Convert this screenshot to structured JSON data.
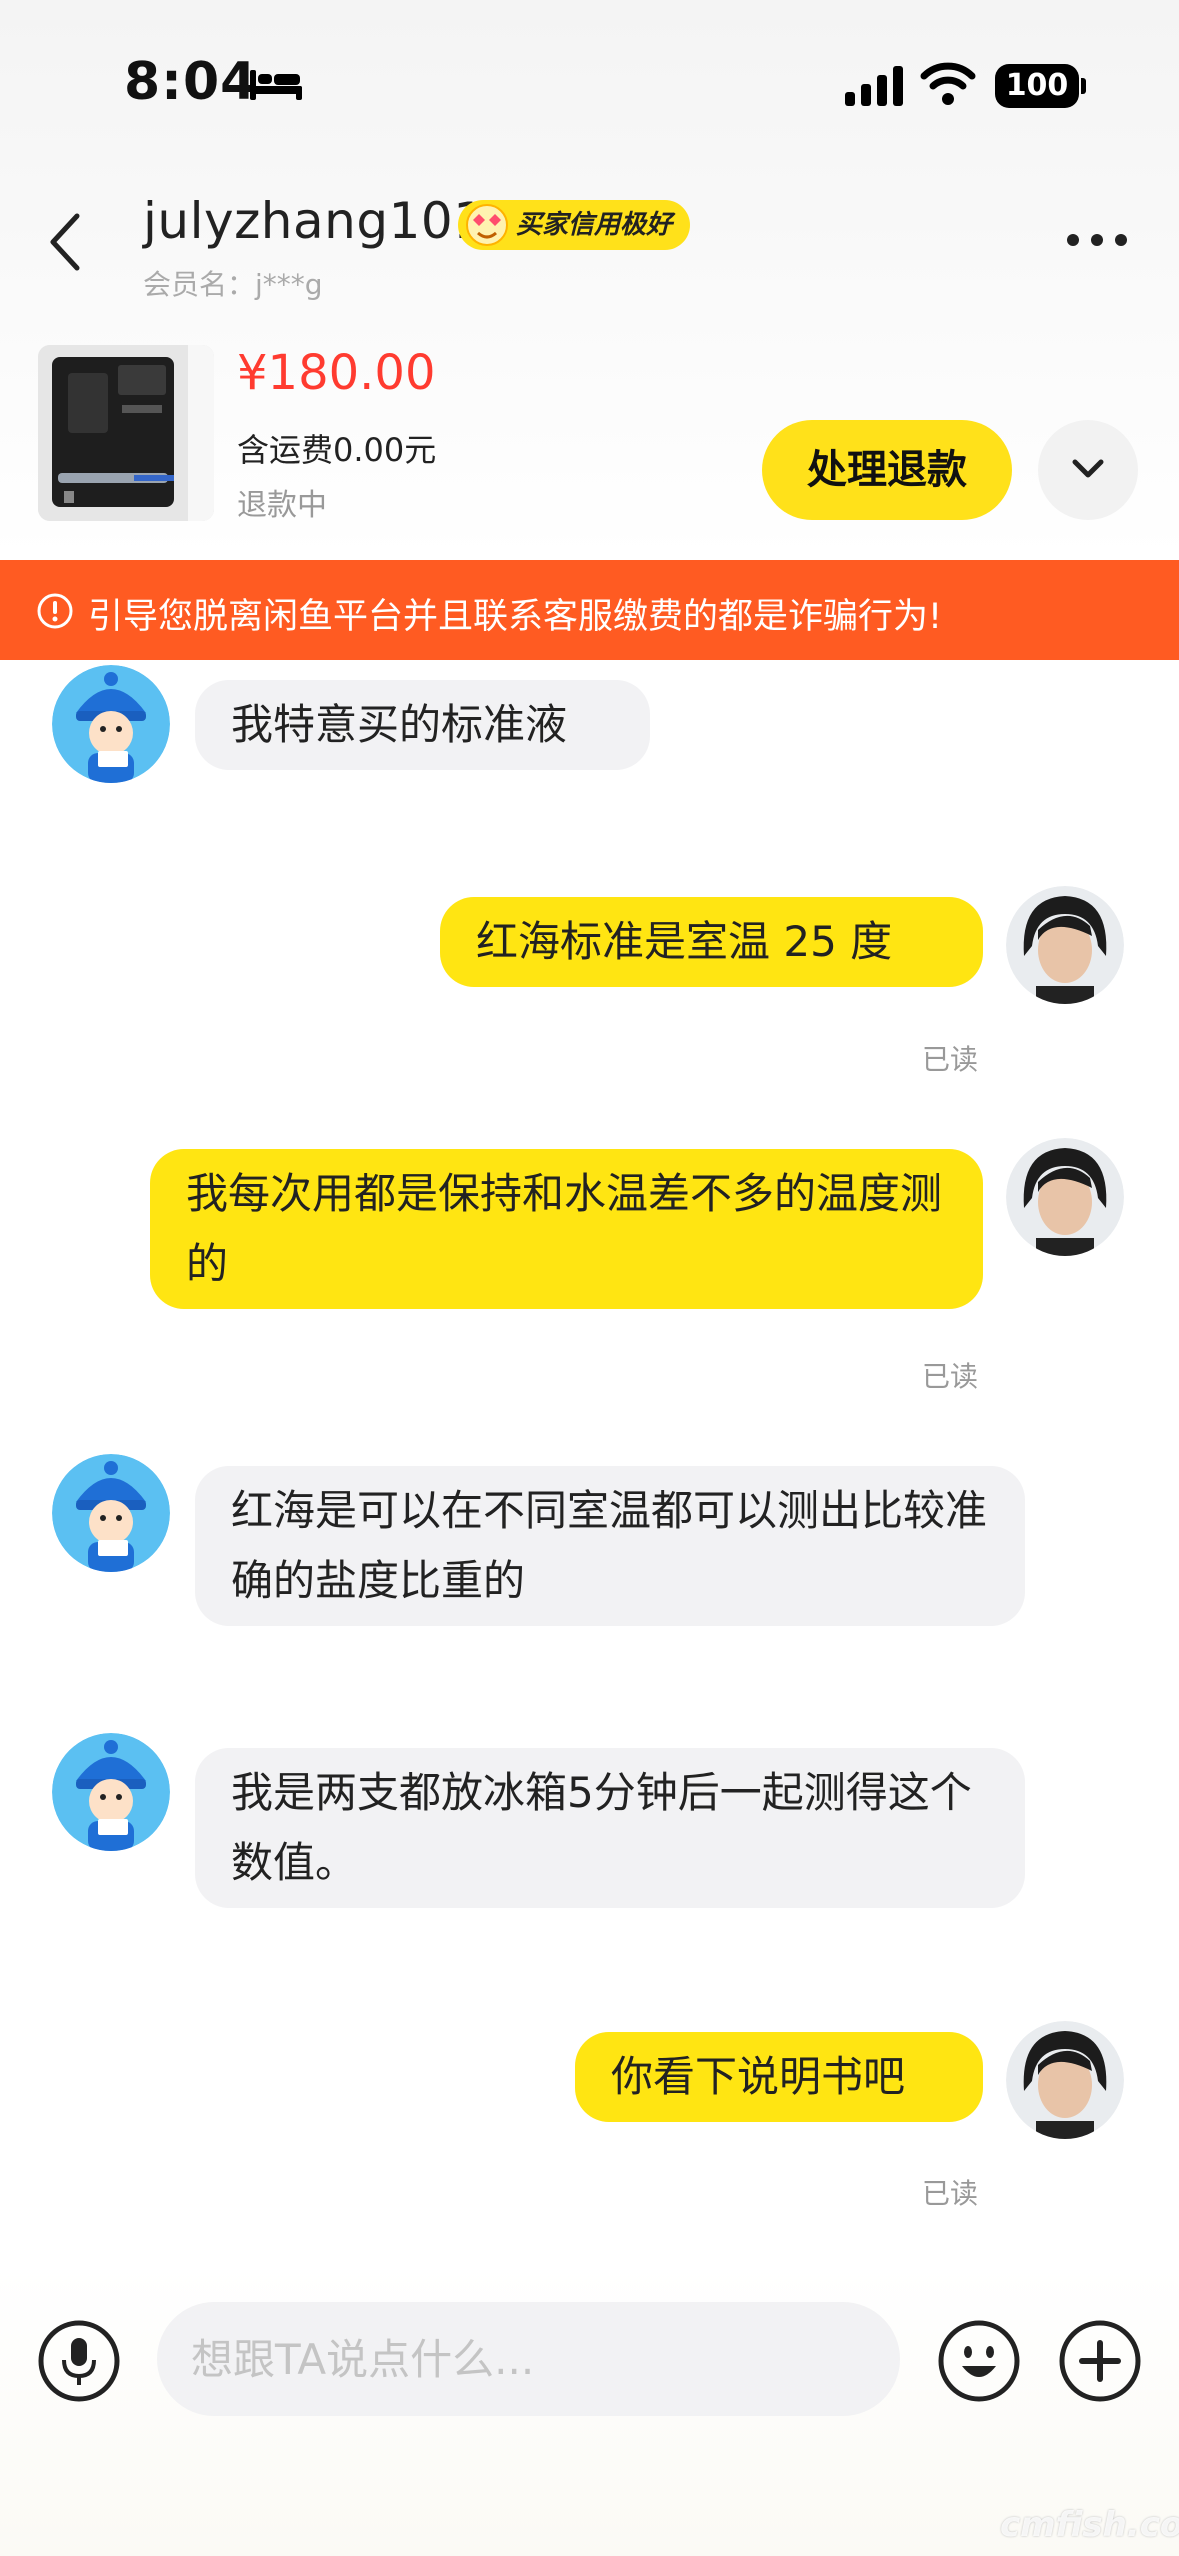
{
  "status_bar": {
    "time": "8:04",
    "battery": "100"
  },
  "header": {
    "user_name": "julyzhang101",
    "credit_badge": "买家信用极好",
    "member_label": "会员名：j***g"
  },
  "product": {
    "price": "¥180.00",
    "shipping": "含运费0.00元",
    "status": "退款中",
    "action_button": "处理退款"
  },
  "warning_banner": "引导您脱离闲鱼平台并且联系客服缴费的都是诈骗行为!",
  "messages": [
    {
      "side": "left",
      "text": "我特意买的标准液"
    },
    {
      "side": "right",
      "text": "红海标准是室温 25 度",
      "read": "已读"
    },
    {
      "side": "right",
      "text": "我每次用都是保持和水温差不多的温度测的",
      "read": "已读"
    },
    {
      "side": "left",
      "text": "红海是可以在不同室温都可以测出比较准确的盐度比重的"
    },
    {
      "side": "left",
      "text": "我是两支都放冰箱5分钟后一起测得这个数值。"
    },
    {
      "side": "right",
      "text": "你看下说明书吧",
      "read": "已读"
    }
  ],
  "input": {
    "placeholder": "想跟TA说点什么..."
  },
  "watermark": "cmfish.com",
  "colors": {
    "accent_yellow": "#ffe512",
    "warning_orange": "#ff5b22",
    "price_red": "#ff3b30"
  }
}
